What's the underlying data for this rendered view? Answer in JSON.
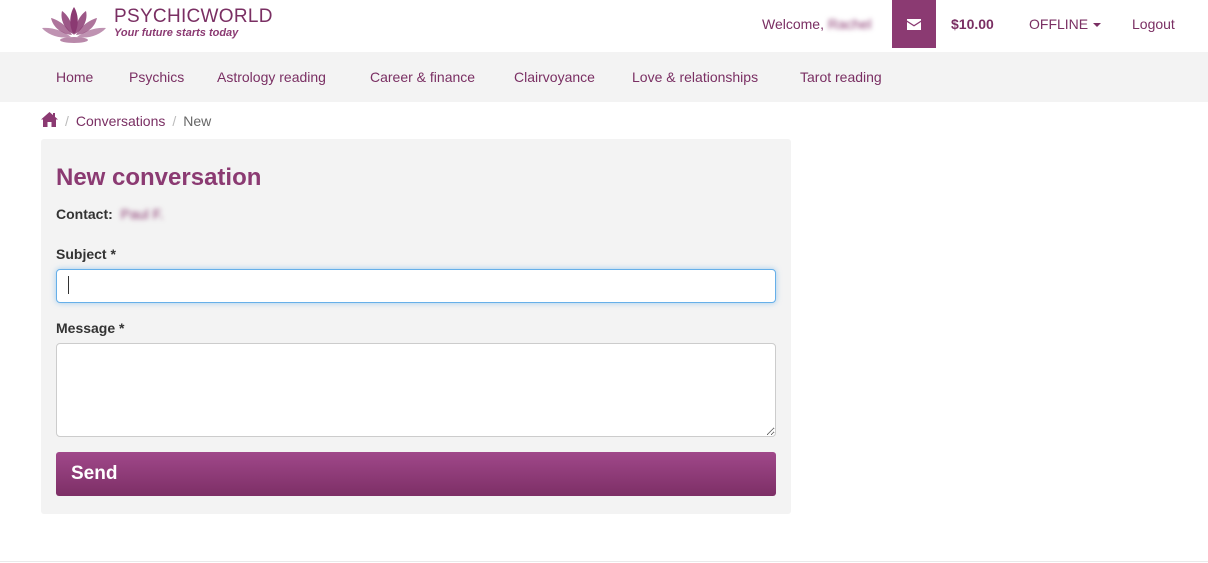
{
  "header": {
    "logo_title": "PSYCHICWORLD",
    "logo_tagline": "Your future starts today",
    "welcome_label": "Welcome,",
    "welcome_name": "Rachel",
    "balance": "$10.00",
    "status": "OFFLINE",
    "logout": "Logout",
    "mail_icon": "envelope-icon"
  },
  "nav": {
    "items": [
      {
        "label": "Home"
      },
      {
        "label": "Psychics"
      },
      {
        "label": "Astrology reading"
      },
      {
        "label": "Career & finance"
      },
      {
        "label": "Clairvoyance"
      },
      {
        "label": "Love & relationships"
      },
      {
        "label": "Tarot reading"
      }
    ]
  },
  "breadcrumb": {
    "home_icon": "home-icon",
    "separator": "/",
    "items": [
      {
        "label": "Conversations"
      },
      {
        "label": "New"
      }
    ]
  },
  "form": {
    "title": "New conversation",
    "contact_label": "Contact:",
    "contact_name": "Paul F.",
    "subject_label": "Subject *",
    "subject_value": "",
    "message_label": "Message *",
    "message_value": "",
    "send_label": "Send"
  },
  "colors": {
    "brand": "#8b3a72",
    "nav_bg": "#f3f3f3",
    "focus": "#66afe9"
  }
}
